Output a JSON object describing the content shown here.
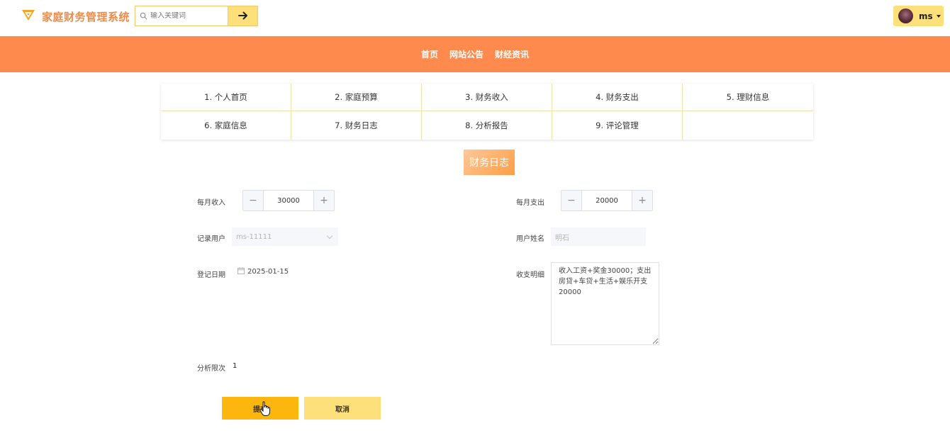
{
  "header": {
    "app_title": "家庭财务管理系统",
    "search_placeholder": "输入关键词",
    "user_name": "ms"
  },
  "nav": {
    "items": [
      "首页",
      "网站公告",
      "财经资讯"
    ]
  },
  "menu": {
    "items": [
      "1. 个人首页",
      "2. 家庭预算",
      "3. 财务收入",
      "4. 财务支出",
      "5. 理财信息",
      "6. 家庭信息",
      "7. 财务日志",
      "8. 分析报告",
      "9. 评论管理",
      ""
    ]
  },
  "section": {
    "title": "财务日志"
  },
  "form": {
    "monthly_income": {
      "label": "每月收入",
      "value": "30000"
    },
    "monthly_expense": {
      "label": "每月支出",
      "value": "20000"
    },
    "record_user": {
      "label": "记录用户",
      "value": "ms-11111"
    },
    "user_real_name": {
      "label": "用户姓名",
      "value": "明石"
    },
    "register_date": {
      "label": "登记日期",
      "value": "2025-01-15"
    },
    "details": {
      "label": "收支明细",
      "value": "收入工资+奖金30000；支出房贷+车贷+生活+娱乐开支20000"
    },
    "analysis_count": {
      "label": "分析限次",
      "value": "1"
    }
  },
  "buttons": {
    "submit": "提交",
    "cancel": "取消"
  },
  "colors": {
    "brand": "#f08a48",
    "nav_bg": "#ff8a4d",
    "accent_yellow": "#fde07a",
    "submit": "#fdb60e"
  }
}
